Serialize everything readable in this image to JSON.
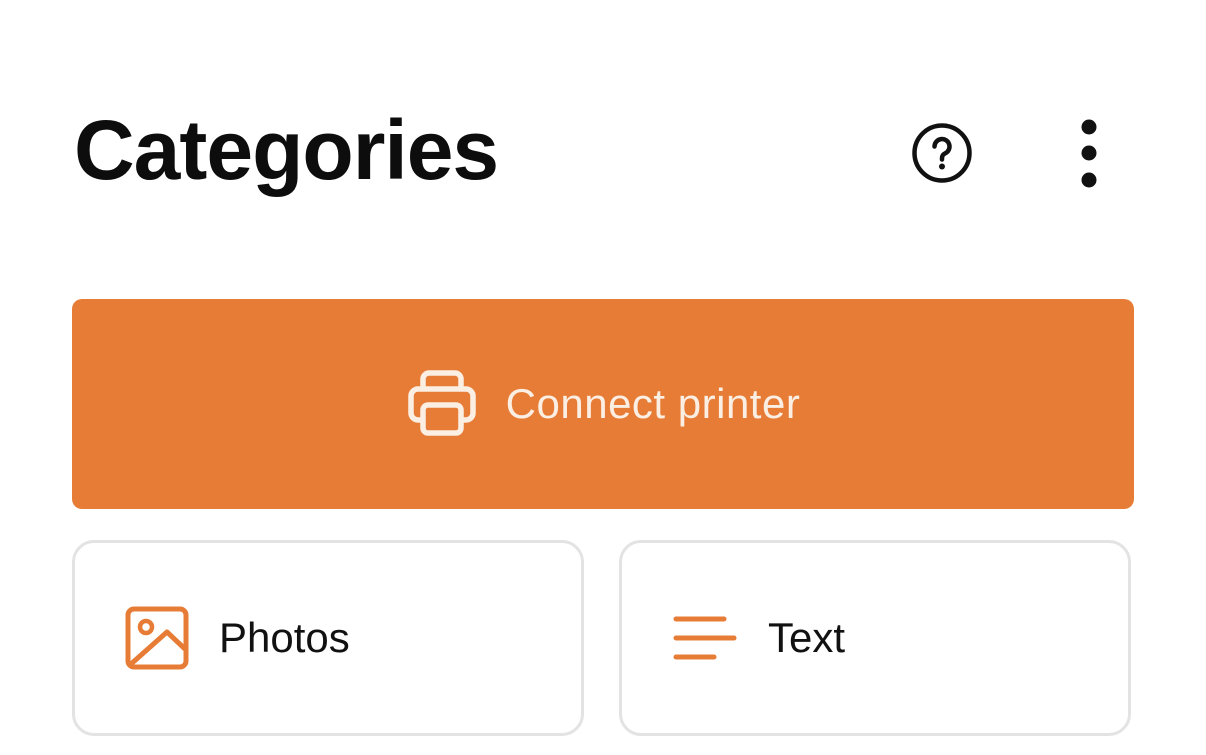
{
  "header": {
    "title": "Categories",
    "help_icon": "help-circle-icon",
    "more_icon": "more-vertical-icon"
  },
  "connect": {
    "label": "Connect printer",
    "icon": "printer-icon"
  },
  "categories": [
    {
      "label": "Photos",
      "icon": "image-icon"
    },
    {
      "label": "Text",
      "icon": "text-lines-icon"
    }
  ],
  "colors": {
    "accent": "#e77c36",
    "on_accent": "#fbeee3",
    "title": "#0d0d0d",
    "card_border": "#e3e3e3"
  }
}
